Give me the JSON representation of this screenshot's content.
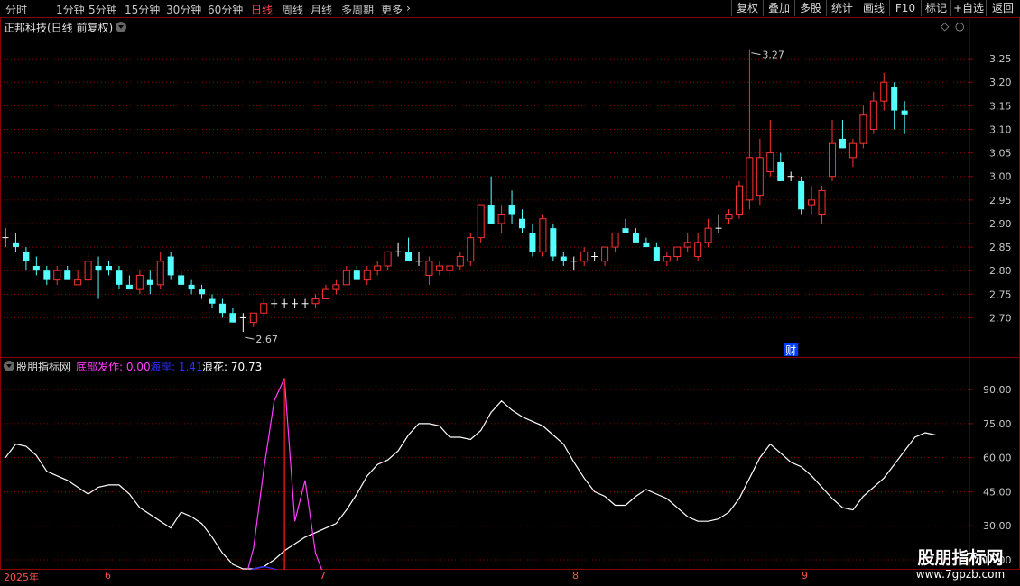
{
  "toolbar": {
    "periods": [
      "分时",
      "1分钟",
      "5分钟",
      "15分钟",
      "30分钟",
      "60分钟",
      "日线",
      "周线",
      "月线",
      "多周期",
      "更多"
    ],
    "active": "日线",
    "buttons": [
      "复权",
      "叠加",
      "多股",
      "统计",
      "画线",
      "F10",
      "标记",
      "+自选",
      "返回"
    ]
  },
  "main": {
    "title": "正邦科技(日线 前复权)",
    "high_label": "3.27",
    "low_label": "2.67",
    "fin_marker": "财",
    "yticks": [
      "3.25",
      "3.20",
      "3.15",
      "3.10",
      "3.05",
      "3.00",
      "2.95",
      "2.90",
      "2.85",
      "2.80",
      "2.75",
      "2.70"
    ]
  },
  "indicator": {
    "name": "股朋指标网",
    "lines": [
      {
        "label": "底部发作: 0.00",
        "color": "#ff3dff"
      },
      {
        "label": "海岸: 1.41",
        "color": "#3030ff"
      },
      {
        "label": "浪花: 70.73",
        "color": "#ffffff"
      }
    ],
    "yticks": [
      "90.00",
      "75.00",
      "60.00",
      "45.00",
      "30.00",
      "15.00"
    ]
  },
  "dates": [
    "2025年",
    "6",
    "7",
    "8",
    "9"
  ],
  "watermark": {
    "name": "股朋指标网",
    "url": "www.7gpzb.com"
  },
  "colors": {
    "up": "#ff3232",
    "down": "#54ffff",
    "grid": "#8b0000"
  },
  "chart_data": [
    {
      "type": "candlestick",
      "title": "正邦科技(日线 前复权)",
      "ylim": [
        2.63,
        3.3
      ],
      "annotations": [
        {
          "text": "3.27",
          "kind": "high"
        },
        {
          "text": "2.67",
          "kind": "low"
        }
      ],
      "ohlc": [
        [
          2.87,
          2.89,
          2.85,
          2.87
        ],
        [
          2.86,
          2.88,
          2.84,
          2.85
        ],
        [
          2.84,
          2.85,
          2.8,
          2.82
        ],
        [
          2.81,
          2.83,
          2.79,
          2.8
        ],
        [
          2.8,
          2.81,
          2.77,
          2.78
        ],
        [
          2.78,
          2.81,
          2.77,
          2.8
        ],
        [
          2.8,
          2.81,
          2.78,
          2.78
        ],
        [
          2.77,
          2.8,
          2.77,
          2.78
        ],
        [
          2.78,
          2.84,
          2.76,
          2.82
        ],
        [
          2.81,
          2.83,
          2.74,
          2.8
        ],
        [
          2.81,
          2.82,
          2.79,
          2.8
        ],
        [
          2.8,
          2.81,
          2.76,
          2.77
        ],
        [
          2.77,
          2.79,
          2.76,
          2.76
        ],
        [
          2.76,
          2.8,
          2.75,
          2.79
        ],
        [
          2.78,
          2.8,
          2.75,
          2.77
        ],
        [
          2.77,
          2.84,
          2.76,
          2.82
        ],
        [
          2.83,
          2.84,
          2.78,
          2.79
        ],
        [
          2.79,
          2.8,
          2.77,
          2.77
        ],
        [
          2.77,
          2.78,
          2.75,
          2.76
        ],
        [
          2.76,
          2.77,
          2.74,
          2.75
        ],
        [
          2.74,
          2.75,
          2.72,
          2.73
        ],
        [
          2.73,
          2.74,
          2.7,
          2.71
        ],
        [
          2.71,
          2.72,
          2.69,
          2.69
        ],
        [
          2.7,
          2.71,
          2.67,
          2.7
        ],
        [
          2.69,
          2.71,
          2.68,
          2.71
        ],
        [
          2.71,
          2.74,
          2.7,
          2.73
        ],
        [
          2.73,
          2.74,
          2.72,
          2.73
        ],
        [
          2.73,
          2.74,
          2.72,
          2.73
        ],
        [
          2.73,
          2.74,
          2.72,
          2.73
        ],
        [
          2.73,
          2.74,
          2.72,
          2.73
        ],
        [
          2.73,
          2.75,
          2.72,
          2.74
        ],
        [
          2.74,
          2.77,
          2.74,
          2.76
        ],
        [
          2.76,
          2.78,
          2.75,
          2.77
        ],
        [
          2.77,
          2.81,
          2.77,
          2.8
        ],
        [
          2.8,
          2.81,
          2.78,
          2.78
        ],
        [
          2.78,
          2.81,
          2.77,
          2.8
        ],
        [
          2.8,
          2.82,
          2.79,
          2.81
        ],
        [
          2.81,
          2.84,
          2.8,
          2.84
        ],
        [
          2.84,
          2.86,
          2.83,
          2.84
        ],
        [
          2.84,
          2.87,
          2.83,
          2.82
        ],
        [
          2.82,
          2.84,
          2.81,
          2.82
        ],
        [
          2.79,
          2.83,
          2.77,
          2.82
        ],
        [
          2.8,
          2.82,
          2.79,
          2.81
        ],
        [
          2.8,
          2.81,
          2.79,
          2.81
        ],
        [
          2.81,
          2.84,
          2.8,
          2.83
        ],
        [
          2.82,
          2.88,
          2.81,
          2.87
        ],
        [
          2.87,
          2.94,
          2.86,
          2.94
        ],
        [
          2.94,
          3.0,
          2.9,
          2.9
        ],
        [
          2.9,
          2.94,
          2.88,
          2.92
        ],
        [
          2.94,
          2.97,
          2.9,
          2.92
        ],
        [
          2.91,
          2.93,
          2.88,
          2.89
        ],
        [
          2.88,
          2.9,
          2.83,
          2.84
        ],
        [
          2.84,
          2.92,
          2.83,
          2.91
        ],
        [
          2.89,
          2.9,
          2.82,
          2.83
        ],
        [
          2.83,
          2.84,
          2.81,
          2.82
        ],
        [
          2.82,
          2.83,
          2.8,
          2.82
        ],
        [
          2.82,
          2.85,
          2.81,
          2.84
        ],
        [
          2.83,
          2.84,
          2.82,
          2.83
        ],
        [
          2.82,
          2.85,
          2.81,
          2.85
        ],
        [
          2.85,
          2.88,
          2.84,
          2.88
        ],
        [
          2.89,
          2.91,
          2.88,
          2.88
        ],
        [
          2.88,
          2.89,
          2.86,
          2.86
        ],
        [
          2.86,
          2.87,
          2.85,
          2.85
        ],
        [
          2.85,
          2.86,
          2.82,
          2.82
        ],
        [
          2.82,
          2.84,
          2.81,
          2.83
        ],
        [
          2.83,
          2.85,
          2.82,
          2.85
        ],
        [
          2.85,
          2.88,
          2.84,
          2.86
        ],
        [
          2.83,
          2.88,
          2.82,
          2.86
        ],
        [
          2.86,
          2.91,
          2.85,
          2.89
        ],
        [
          2.89,
          2.92,
          2.88,
          2.89
        ],
        [
          2.91,
          2.93,
          2.9,
          2.92
        ],
        [
          2.92,
          2.99,
          2.91,
          2.98
        ],
        [
          2.95,
          3.27,
          2.93,
          3.04
        ],
        [
          2.96,
          3.08,
          2.94,
          3.04
        ],
        [
          3.01,
          3.12,
          3.0,
          3.05
        ],
        [
          3.03,
          3.05,
          2.99,
          2.99
        ],
        [
          3.0,
          3.01,
          2.99,
          3.0
        ],
        [
          2.99,
          3.0,
          2.92,
          2.93
        ],
        [
          2.94,
          2.98,
          2.92,
          2.95
        ],
        [
          2.92,
          2.98,
          2.9,
          2.97
        ],
        [
          3.0,
          3.12,
          2.99,
          3.07
        ],
        [
          3.08,
          3.12,
          3.06,
          3.06
        ],
        [
          3.04,
          3.08,
          3.02,
          3.07
        ],
        [
          3.07,
          3.15,
          3.06,
          3.13
        ],
        [
          3.1,
          3.18,
          3.09,
          3.16
        ],
        [
          3.16,
          3.22,
          3.14,
          3.2
        ],
        [
          3.19,
          3.2,
          3.1,
          3.14
        ],
        [
          3.14,
          3.16,
          3.09,
          3.13
        ]
      ]
    },
    {
      "type": "line",
      "title": "股朋指标网",
      "ylim": [
        13,
        98
      ],
      "series": [
        {
          "name": "浪花",
          "color": "#ffffff",
          "values": [
            60,
            66,
            65,
            61,
            54,
            52,
            50,
            47,
            44,
            47,
            48,
            48,
            44,
            38,
            35,
            32,
            29,
            36,
            34,
            31,
            25,
            18,
            13,
            11,
            11,
            12,
            15,
            19,
            22,
            25,
            27,
            29,
            31,
            37,
            44,
            52,
            57,
            59,
            63,
            70,
            75,
            75,
            74,
            69,
            69,
            68,
            72,
            80,
            85,
            81,
            78,
            76,
            74,
            70,
            66,
            58,
            51,
            45,
            43,
            39,
            39,
            43,
            46,
            44,
            42,
            38,
            34,
            32,
            32,
            33,
            36,
            42,
            51,
            60,
            66,
            62,
            58,
            56,
            52,
            47,
            42,
            38,
            37,
            43,
            47,
            51,
            57,
            63,
            69,
            71,
            70
          ]
        },
        {
          "name": "底部发作",
          "color": "#ff3dff",
          "values": [
            0,
            0,
            0,
            0,
            0,
            0,
            0,
            0,
            0,
            0,
            0,
            0,
            0,
            0,
            0,
            0,
            0,
            0,
            0,
            0,
            0,
            0,
            0,
            3,
            20,
            55,
            85,
            95,
            32,
            50,
            18,
            6,
            2,
            1,
            0,
            0,
            0,
            0,
            0,
            0,
            0,
            0,
            0,
            0,
            0,
            0,
            0,
            0,
            0,
            0,
            0,
            0,
            0,
            0,
            0,
            0,
            0,
            0,
            0,
            0,
            0,
            0,
            0,
            0,
            0,
            0,
            0,
            0,
            0,
            0,
            0,
            0,
            0,
            0,
            0,
            0,
            0,
            0,
            0,
            0,
            0,
            0,
            0,
            0,
            0,
            0,
            0,
            0,
            0,
            0,
            0
          ]
        },
        {
          "name": "海岸",
          "color": "#3030ff",
          "values": [
            2,
            2,
            2,
            2,
            2,
            2,
            2,
            2,
            2,
            2,
            2,
            2,
            2,
            2,
            2,
            2,
            3,
            3,
            3,
            3,
            4,
            5,
            7,
            9,
            11,
            12,
            11,
            9,
            7,
            6,
            5,
            4,
            3,
            3,
            2,
            2,
            2,
            2,
            2,
            2,
            2,
            2,
            2,
            2,
            2,
            2,
            2,
            2,
            2,
            2,
            2,
            2,
            2,
            2,
            2,
            2,
            2,
            2,
            2,
            2,
            2,
            2,
            2,
            2,
            2,
            2,
            2,
            2,
            2,
            2,
            2,
            2,
            2,
            2,
            2,
            2,
            2,
            2,
            2,
            2,
            2,
            2,
            2,
            2,
            2,
            2,
            2,
            2,
            2,
            1.5,
            1.41
          ]
        }
      ]
    }
  ]
}
